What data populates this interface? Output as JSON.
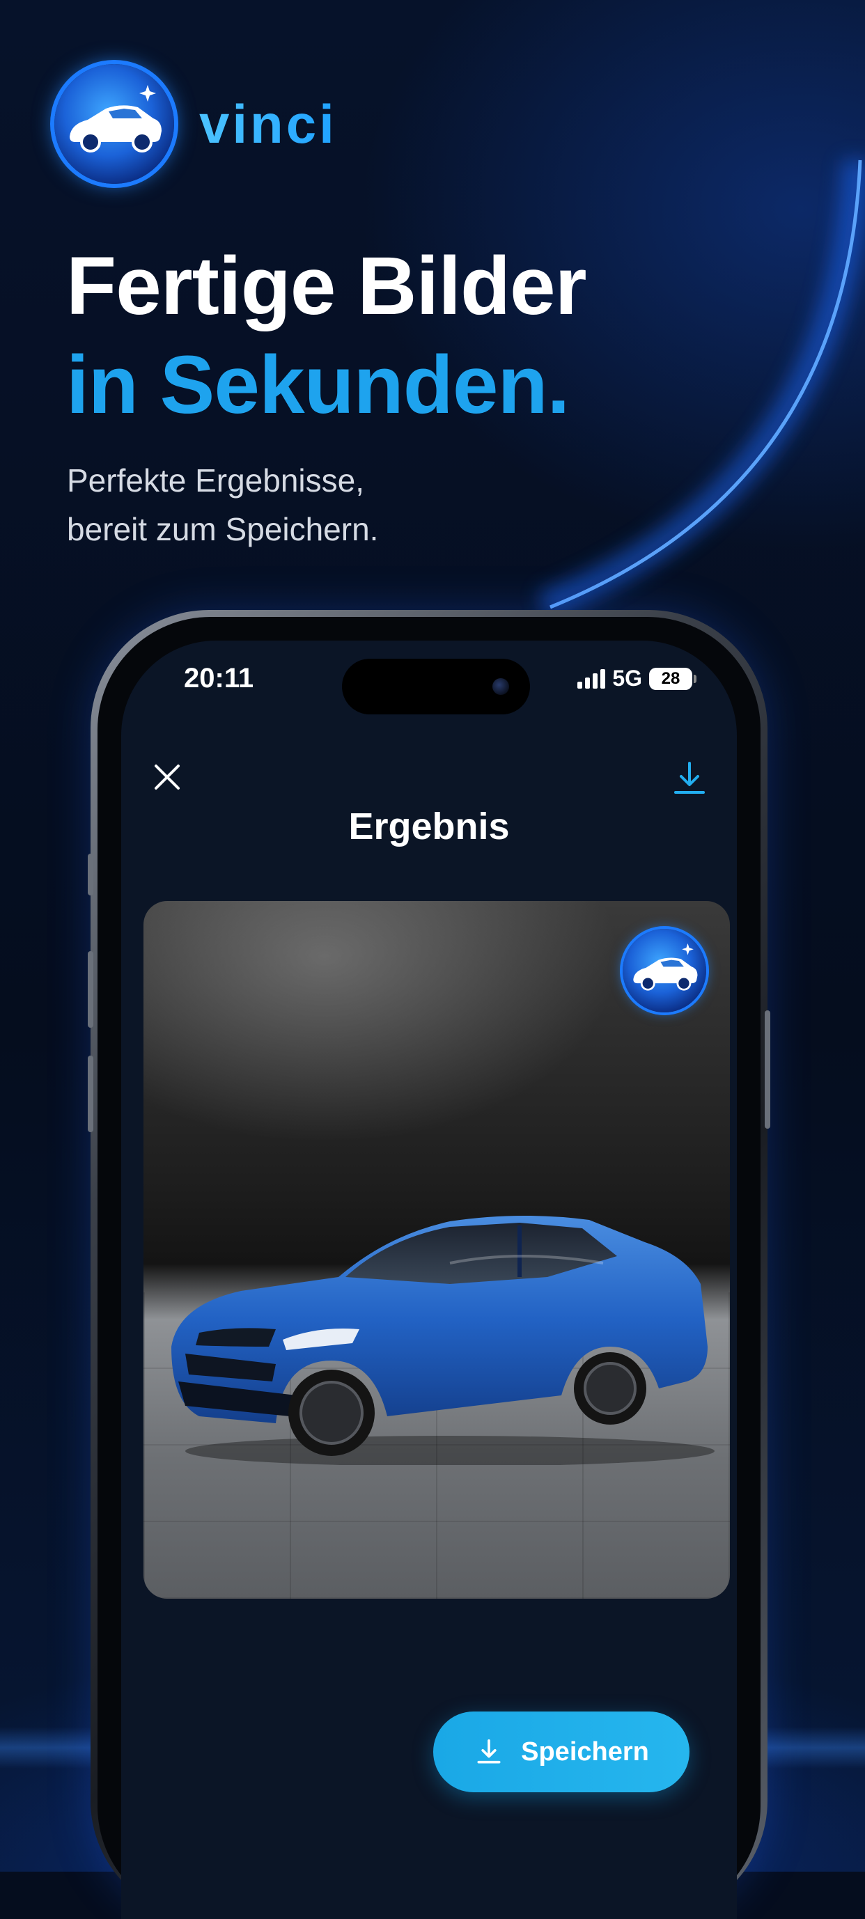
{
  "brand": {
    "name": "vinci",
    "logo_icon": "car-badge-icon"
  },
  "hero": {
    "headline_line1": "Fertige Bilder",
    "headline_line2": "in Sekunden.",
    "subline_line1": "Perfekte Ergebnisse,",
    "subline_line2": "bereit zum Speichern."
  },
  "status_bar": {
    "time": "20:11",
    "network": "5G",
    "battery": "28"
  },
  "screen": {
    "title": "Ergebnis",
    "close_icon": "close-icon",
    "download_icon": "download-icon"
  },
  "result": {
    "image": "blue-sedan-studio-photo",
    "watermark_icon": "car-badge-icon"
  },
  "actions": {
    "save_label": "Speichern",
    "save_icon": "download-icon"
  },
  "colors": {
    "background": "#050d1e",
    "accent": "#1ea3ee",
    "button": "#1aa8e6",
    "screen_bg": "#0b1526"
  }
}
